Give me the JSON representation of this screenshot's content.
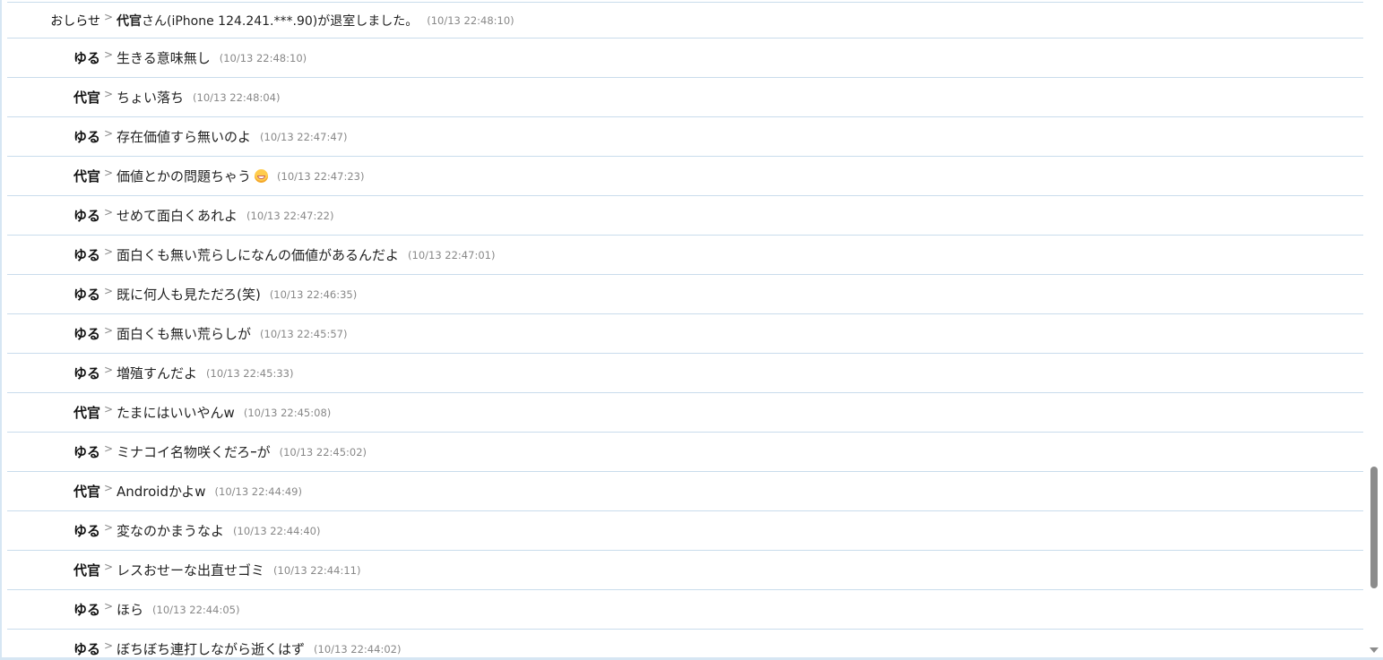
{
  "messages": [
    {
      "name": "おしらせ",
      "sep": ">",
      "msg_bold": "代官",
      "text": "さん(iPhone 124.241.***.90)が退室しました。",
      "time": "(10/13 22:48:10)"
    },
    {
      "name": "ゆる",
      "sep": ">",
      "text": "生きる意味無し",
      "time": "(10/13 22:48:10)"
    },
    {
      "name": "代官",
      "sep": ">",
      "text": "ちょい落ち",
      "time": "(10/13 22:48:04)"
    },
    {
      "name": "ゆる",
      "sep": ">",
      "text": "存在価値すら無いのよ",
      "time": "(10/13 22:47:47)"
    },
    {
      "name": "代官",
      "sep": ">",
      "text": "価値とかの問題ちゃう",
      "emoji": "grinning-face-emoji",
      "time": "(10/13 22:47:23)"
    },
    {
      "name": "ゆる",
      "sep": ">",
      "text": "せめて面白くあれよ",
      "time": "(10/13 22:47:22)"
    },
    {
      "name": "ゆる",
      "sep": ">",
      "text": "面白くも無い荒らしになんの価値があるんだよ",
      "time": "(10/13 22:47:01)"
    },
    {
      "name": "ゆる",
      "sep": ">",
      "text": "既に何人も見ただろ(笑)",
      "time": "(10/13 22:46:35)"
    },
    {
      "name": "ゆる",
      "sep": ">",
      "text": "面白くも無い荒らしが",
      "time": "(10/13 22:45:57)"
    },
    {
      "name": "ゆる",
      "sep": ">",
      "text": "増殖すんだよ",
      "time": "(10/13 22:45:33)"
    },
    {
      "name": "代官",
      "sep": ">",
      "text": "たまにはいいやんw",
      "time": "(10/13 22:45:08)"
    },
    {
      "name": "ゆる",
      "sep": ">",
      "text": "ミナコイ名物咲くだろｰが",
      "time": "(10/13 22:45:02)"
    },
    {
      "name": "代官",
      "sep": ">",
      "text": "Androidかよw",
      "time": "(10/13 22:44:49)"
    },
    {
      "name": "ゆる",
      "sep": ">",
      "text": "変なのかまうなよ",
      "time": "(10/13 22:44:40)"
    },
    {
      "name": "代官",
      "sep": ">",
      "text": "レスおせーな出直せゴミ",
      "time": "(10/13 22:44:11)"
    },
    {
      "name": "ゆる",
      "sep": ">",
      "text": "ほら",
      "time": "(10/13 22:44:05)"
    },
    {
      "name": "ゆる",
      "sep": ">",
      "text": "ぼちぼち連打しながら逝くはず",
      "time": "(10/13 22:44:02)"
    }
  ],
  "scrollbar": {
    "position_fraction": 0.75,
    "down_arrow_icon": "chevron-down-icon"
  }
}
